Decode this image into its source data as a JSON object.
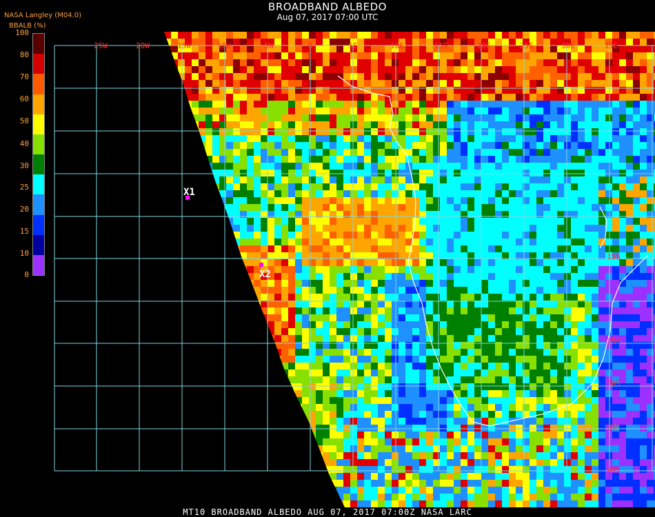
{
  "header": {
    "title": "BROADBAND ALBEDO",
    "subtitle": "Aug 07, 2017 07:00 UTC",
    "source": "NASA Langley (M04.0)",
    "variable": "BBALB (%)"
  },
  "colorbar": {
    "ticks": [
      "100",
      "80",
      "70",
      "60",
      "50",
      "40",
      "30",
      "25",
      "20",
      "15",
      "10",
      "0"
    ],
    "colors": [
      "#5a0000",
      "#d40000",
      "#ff5a00",
      "#ffa500",
      "#ffff00",
      "#88e000",
      "#008000",
      "#00ffff",
      "#1e90ff",
      "#0030ff",
      "#0000a0",
      "#9b30ff"
    ]
  },
  "map": {
    "lon_labels": [
      "25W",
      "20W",
      "15W",
      "10W",
      "5W",
      "0",
      "5E",
      "10E",
      "15E",
      "20E",
      "25E",
      "30E",
      "35E"
    ],
    "lat_labels": [
      "15S",
      "25S",
      "30S",
      "35S",
      "40S"
    ],
    "markers": [
      {
        "label": "X1"
      },
      {
        "label": "X2"
      }
    ]
  },
  "footer": {
    "text": "MT10  BROADBAND ALBEDO   AUG 07, 2017 07:00Z   NASA LARC"
  }
}
